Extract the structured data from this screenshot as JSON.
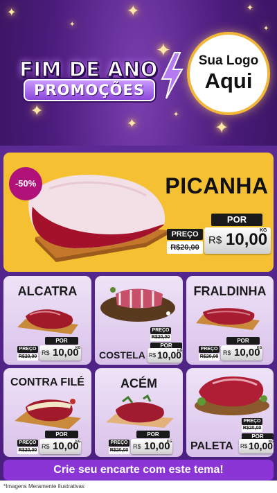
{
  "header": {
    "title_line1": "FIM DE ANO",
    "title_line2": "PROMOÇÕES",
    "logo_line1": "Sua Logo",
    "logo_line2": "Aqui"
  },
  "hero": {
    "discount": "-50%",
    "name": "PICANHA",
    "preco_label": "PREÇO",
    "por_label": "POR",
    "old_price": "R$20,00",
    "currency": "R$",
    "new_price": "10,00",
    "unit": "KG"
  },
  "products": [
    {
      "name": "ALCATRA",
      "preco_label": "PREÇO",
      "por_label": "POR",
      "old_price": "R$20,00",
      "currency": "R$",
      "new_price": "10,00",
      "unit": "KG"
    },
    {
      "name": "COSTELA",
      "preco_label": "PREÇO",
      "por_label": "POR",
      "old_price": "R$20,00",
      "currency": "R$",
      "new_price": "10,00",
      "unit": "KG"
    },
    {
      "name": "FRALDINHA",
      "preco_label": "PREÇO",
      "por_label": "POR",
      "old_price": "R$20,00",
      "currency": "R$",
      "new_price": "10,00",
      "unit": "KG"
    },
    {
      "name": "CONTRA FILÉ",
      "preco_label": "PREÇO",
      "por_label": "POR",
      "old_price": "R$20,00",
      "currency": "R$",
      "new_price": "10,00",
      "unit": "KG"
    },
    {
      "name": "ACÉM",
      "preco_label": "PREÇO",
      "por_label": "POR",
      "old_price": "R$20,00",
      "currency": "R$",
      "new_price": "10,00",
      "unit": "KG"
    },
    {
      "name": "PALETA",
      "preco_label": "PREÇO",
      "por_label": "POR",
      "old_price": "R$20,00",
      "currency": "R$",
      "new_price": "10,00",
      "unit": "KG"
    }
  ],
  "cta": {
    "label": "Crie seu encarte com este tema!"
  },
  "footer": {
    "disclaimer": "*Imagens Meramente Ilustrativas"
  },
  "colors": {
    "background": "#4b1c7c",
    "hero_card": "#f5c133",
    "badge": "#b0127a",
    "cta": "#8c35d6",
    "accent_gold": "#f2b73a"
  }
}
